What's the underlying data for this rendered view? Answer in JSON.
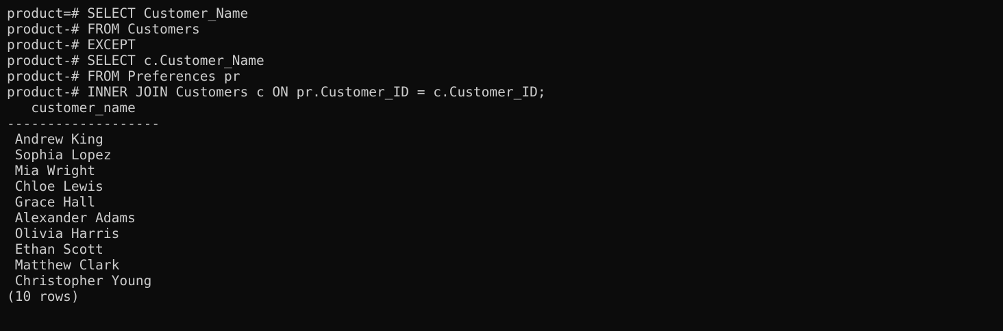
{
  "terminal": {
    "query_lines": [
      {
        "prompt": "product=# ",
        "sql": "SELECT Customer_Name"
      },
      {
        "prompt": "product-# ",
        "sql": "FROM Customers"
      },
      {
        "prompt": "product-# ",
        "sql": "EXCEPT"
      },
      {
        "prompt": "product-# ",
        "sql": "SELECT c.Customer_Name"
      },
      {
        "prompt": "product-# ",
        "sql": "FROM Preferences pr"
      },
      {
        "prompt": "product-# ",
        "sql": "INNER JOIN Customers c ON pr.Customer_ID = c.Customer_ID;"
      }
    ],
    "result": {
      "header": "   customer_name",
      "separator": "-------------------",
      "rows": [
        " Andrew King",
        " Sophia Lopez",
        " Mia Wright",
        " Chloe Lewis",
        " Grace Hall",
        " Alexander Adams",
        " Olivia Harris",
        " Ethan Scott",
        " Matthew Clark",
        " Christopher Young"
      ],
      "footer": "(10 rows)"
    }
  },
  "colors": {
    "background": "#0c0c0c",
    "text": "#cccccc"
  }
}
